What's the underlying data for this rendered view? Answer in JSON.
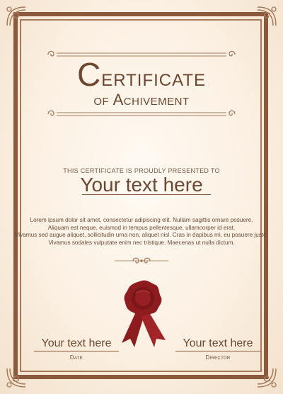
{
  "certificate": {
    "title_first": "C",
    "title_rest": "ertificate",
    "subtitle_first": "of A",
    "subtitle_rest": "chivement",
    "presented_to": "THIS CERTIFICATE IS PROUDLY PRESENTED TO",
    "recipient": "Your text here",
    "body_lines": [
      "Lorem ipsum dolor sit amet, consectetur adipiscing elit. Nullam sagittis ornare posuere.",
      "Aliquam est neque, euismod in tempus pellentesque, ullamcorper id erat.",
      "Vivamus sed augue aliquet, sollicitudin urna non, aliquet nisl. Cras in dapibus mi, eu posuere justo.",
      "Vivamus sodales vulputate enim nec tristique. Maecenas ut nulla dictum."
    ],
    "signatures": [
      {
        "name": "Your text here",
        "role": "Date"
      },
      {
        "name": "Your text here",
        "role": "Director"
      }
    ]
  },
  "colors": {
    "frame": "#8b5a3c",
    "text": "#6e4730",
    "seal": "#8e1c1f",
    "background": "#fbf2e6"
  },
  "icons": {
    "corner": "corner-flourish-icon",
    "divider": "scroll-divider-icon",
    "seal": "wax-seal-ribbon-icon"
  }
}
